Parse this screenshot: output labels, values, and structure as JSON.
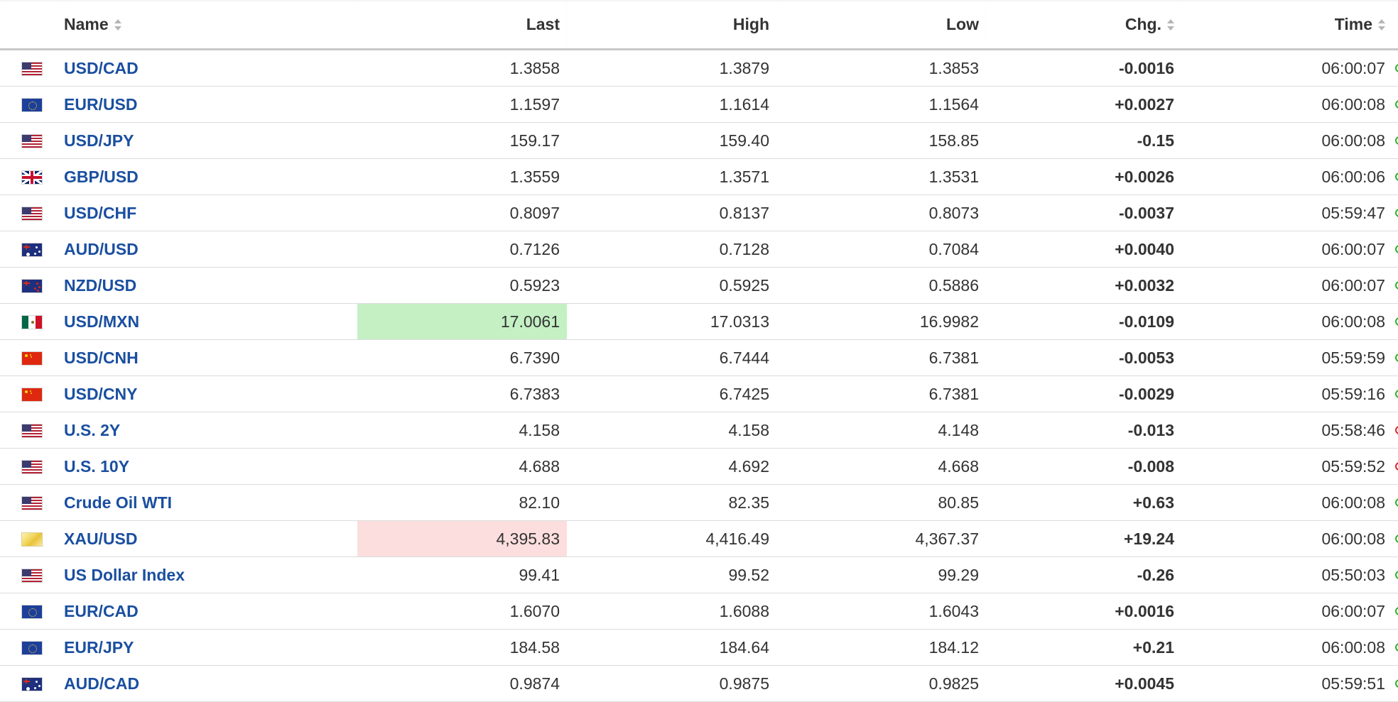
{
  "table": {
    "headers": {
      "name": "Name",
      "last": "Last",
      "high": "High",
      "low": "Low",
      "chg": "Chg.",
      "time": "Time"
    },
    "rows": [
      {
        "flag": "us",
        "name": "USD/CAD",
        "last": "1.3858",
        "high": "1.3879",
        "low": "1.3853",
        "chg": "-0.0016",
        "dir": "down",
        "time": "06:00:07",
        "status": "open",
        "highlight": ""
      },
      {
        "flag": "eu",
        "name": "EUR/USD",
        "last": "1.1597",
        "high": "1.1614",
        "low": "1.1564",
        "chg": "+0.0027",
        "dir": "up",
        "time": "06:00:08",
        "status": "open",
        "highlight": ""
      },
      {
        "flag": "us",
        "name": "USD/JPY",
        "last": "159.17",
        "high": "159.40",
        "low": "158.85",
        "chg": "-0.15",
        "dir": "down",
        "time": "06:00:08",
        "status": "open",
        "highlight": ""
      },
      {
        "flag": "gb",
        "name": "GBP/USD",
        "last": "1.3559",
        "high": "1.3571",
        "low": "1.3531",
        "chg": "+0.0026",
        "dir": "up",
        "time": "06:00:06",
        "status": "open",
        "highlight": ""
      },
      {
        "flag": "us",
        "name": "USD/CHF",
        "last": "0.8097",
        "high": "0.8137",
        "low": "0.8073",
        "chg": "-0.0037",
        "dir": "down",
        "time": "05:59:47",
        "status": "open",
        "highlight": ""
      },
      {
        "flag": "au",
        "name": "AUD/USD",
        "last": "0.7126",
        "high": "0.7128",
        "low": "0.7084",
        "chg": "+0.0040",
        "dir": "up",
        "time": "06:00:07",
        "status": "open",
        "highlight": ""
      },
      {
        "flag": "nz",
        "name": "NZD/USD",
        "last": "0.5923",
        "high": "0.5925",
        "low": "0.5886",
        "chg": "+0.0032",
        "dir": "up",
        "time": "06:00:07",
        "status": "open",
        "highlight": ""
      },
      {
        "flag": "mx",
        "name": "USD/MXN",
        "last": "17.0061",
        "high": "17.0313",
        "low": "16.9982",
        "chg": "-0.0109",
        "dir": "down",
        "time": "06:00:08",
        "status": "open",
        "highlight": "up"
      },
      {
        "flag": "cn",
        "name": "USD/CNH",
        "last": "6.7390",
        "high": "6.7444",
        "low": "6.7381",
        "chg": "-0.0053",
        "dir": "down",
        "time": "05:59:59",
        "status": "open",
        "highlight": ""
      },
      {
        "flag": "cn",
        "name": "USD/CNY",
        "last": "6.7383",
        "high": "6.7425",
        "low": "6.7381",
        "chg": "-0.0029",
        "dir": "down",
        "time": "05:59:16",
        "status": "open",
        "highlight": ""
      },
      {
        "flag": "us",
        "name": "U.S. 2Y",
        "last": "4.158",
        "high": "4.158",
        "low": "4.148",
        "chg": "-0.013",
        "dir": "down",
        "time": "05:58:46",
        "status": "closed",
        "highlight": ""
      },
      {
        "flag": "us",
        "name": "U.S. 10Y",
        "last": "4.688",
        "high": "4.692",
        "low": "4.668",
        "chg": "-0.008",
        "dir": "down",
        "time": "05:59:52",
        "status": "closed",
        "highlight": ""
      },
      {
        "flag": "us",
        "name": "Crude Oil WTI",
        "last": "82.10",
        "high": "82.35",
        "low": "80.85",
        "chg": "+0.63",
        "dir": "up",
        "time": "06:00:08",
        "status": "open",
        "highlight": ""
      },
      {
        "flag": "xau",
        "name": "XAU/USD",
        "last": "4,395.83",
        "high": "4,416.49",
        "low": "4,367.37",
        "chg": "+19.24",
        "dir": "up",
        "time": "06:00:08",
        "status": "open",
        "highlight": "down"
      },
      {
        "flag": "us",
        "name": "US Dollar Index",
        "last": "99.41",
        "high": "99.52",
        "low": "99.29",
        "chg": "-0.26",
        "dir": "down",
        "time": "05:50:03",
        "status": "open",
        "highlight": ""
      },
      {
        "flag": "eu",
        "name": "EUR/CAD",
        "last": "1.6070",
        "high": "1.6088",
        "low": "1.6043",
        "chg": "+0.0016",
        "dir": "up",
        "time": "06:00:07",
        "status": "open",
        "highlight": ""
      },
      {
        "flag": "eu",
        "name": "EUR/JPY",
        "last": "184.58",
        "high": "184.64",
        "low": "184.12",
        "chg": "+0.21",
        "dir": "up",
        "time": "06:00:08",
        "status": "open",
        "highlight": ""
      },
      {
        "flag": "au",
        "name": "AUD/CAD",
        "last": "0.9874",
        "high": "0.9875",
        "low": "0.9825",
        "chg": "+0.0045",
        "dir": "up",
        "time": "05:59:51",
        "status": "open",
        "highlight": ""
      }
    ]
  },
  "colors": {
    "link": "#1a4fa0",
    "up": "#0e9e0e",
    "down": "#e31414",
    "highlight_up": "#c4f0c4",
    "highlight_down": "#fcdede"
  }
}
